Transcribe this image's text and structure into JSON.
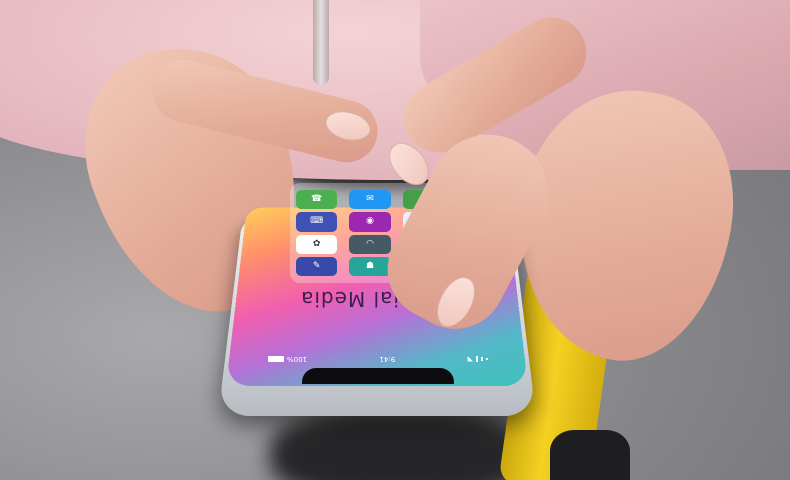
{
  "phone": {
    "folder_title": "Social Media",
    "status_bar": {
      "time": "9:41",
      "battery": "100%"
    },
    "apps": [
      {
        "icon": "phone-icon",
        "color": "#4caf50",
        "glyph": "☎"
      },
      {
        "icon": "messages-icon",
        "color": "#2196f3",
        "glyph": "✉"
      },
      {
        "icon": "call-icon",
        "color": "#43a047",
        "glyph": "✆"
      },
      {
        "icon": "keyboard-icon",
        "color": "#3f51b5",
        "glyph": "⌨"
      },
      {
        "icon": "chat-icon",
        "color": "#9c27b0",
        "glyph": "◉"
      },
      {
        "icon": "wave-icon",
        "color": "#e3f2fd",
        "glyph": "≋"
      },
      {
        "icon": "aperture-icon",
        "color": "#ffffff",
        "glyph": "✿"
      },
      {
        "icon": "headset-icon",
        "color": "#455a64",
        "glyph": "◠"
      },
      {
        "icon": "video-play-icon",
        "color": "#e53935",
        "glyph": "▶"
      },
      {
        "icon": "note-icon",
        "color": "#3949ab",
        "glyph": "✎"
      },
      {
        "icon": "contact-icon",
        "color": "#26a69a",
        "glyph": "☗"
      },
      {
        "icon": "ghost-icon",
        "color": "#fbc02d",
        "glyph": "☺"
      }
    ]
  }
}
